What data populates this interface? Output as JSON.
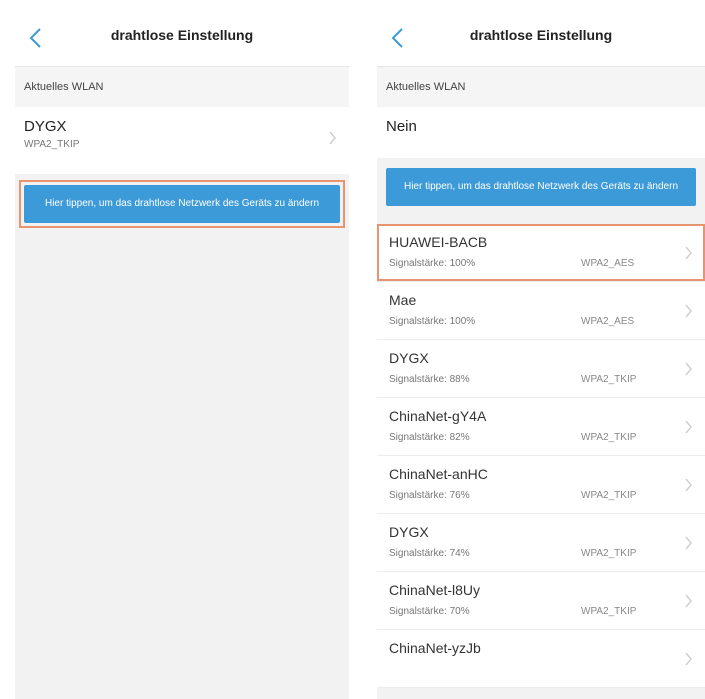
{
  "left": {
    "title": "drahtlose Einstellung",
    "section": "Aktuelles WLAN",
    "current": {
      "ssid": "DYGX",
      "security": "WPA2_TKIP"
    },
    "action_label": "Hier tippen, um das drahtlose Netzwerk des Geräts zu ändern"
  },
  "right": {
    "title": "drahtlose Einstellung",
    "section": "Aktuelles WLAN",
    "current": {
      "ssid": "Nein"
    },
    "action_label": "Hier tippen, um das drahtlose Netzwerk des Geräts zu ändern",
    "networks": [
      {
        "ssid": "HUAWEI-BACB",
        "signal": "Signalstärke: 100%",
        "security": "WPA2_AES"
      },
      {
        "ssid": "Mae",
        "signal": "Signalstärke: 100%",
        "security": "WPA2_AES"
      },
      {
        "ssid": "DYGX",
        "signal": "Signalstärke: 88%",
        "security": "WPA2_TKIP"
      },
      {
        "ssid": "ChinaNet-gY4A",
        "signal": "Signalstärke: 82%",
        "security": "WPA2_TKIP"
      },
      {
        "ssid": "ChinaNet-anHC",
        "signal": "Signalstärke: 76%",
        "security": "WPA2_TKIP"
      },
      {
        "ssid": "DYGX",
        "signal": "Signalstärke: 74%",
        "security": "WPA2_TKIP"
      },
      {
        "ssid": "ChinaNet-l8Uy",
        "signal": "Signalstärke: 70%",
        "security": "WPA2_TKIP"
      },
      {
        "ssid": "ChinaNet-yzJb",
        "signal": "",
        "security": ""
      }
    ]
  },
  "colors": {
    "accent": "#3d9ad9",
    "highlight": "#e79470",
    "background": "#f2f2f2"
  },
  "icons": {
    "back": "chevron-left-icon",
    "row": "chevron-right-icon"
  }
}
